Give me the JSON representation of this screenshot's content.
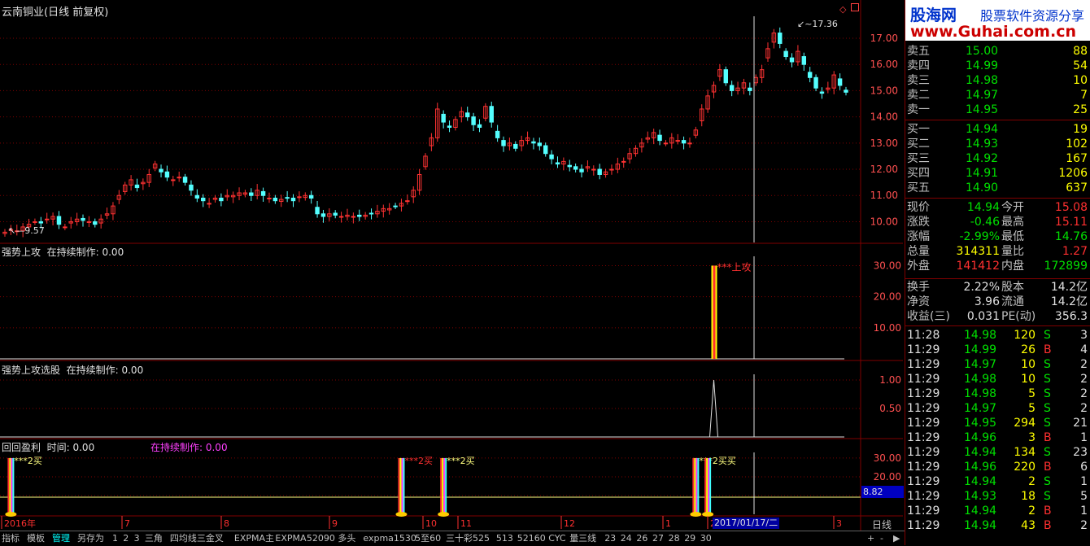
{
  "main_title": "云南铜业(日线 前复权)",
  "panels": {
    "p1_title": "强势上攻  在持续制作: 0.00",
    "p2_title": "强势上攻选股  在持续制作: 0.00",
    "p3_title": "回回盈利  时间: 0.00",
    "p3_subtitle": "在持续制作: 0.00"
  },
  "annotations": {
    "high": "17.36",
    "low": "9.57",
    "up_label": "上攻",
    "buy1": "2买",
    "buy2": "2买",
    "buy3": "2买",
    "buy4": "2买买",
    "value_box": "8.82",
    "date_box": "2017/01/17/二",
    "cycle": "日线"
  },
  "colors": {
    "up": "#ff3232",
    "down": "#54ffff",
    "grid": "#800000",
    "axis_text": "#ff5050",
    "value_box_bg": "#0000c0"
  },
  "chart_data": [
    {
      "type": "candlestick",
      "title": "云南铜业(日线 前复权)",
      "y_ticks": [
        "17.00",
        "16.00",
        "15.00",
        "14.00",
        "13.00",
        "12.00",
        "11.00",
        "10.00"
      ],
      "ylim": [
        9.3,
        17.9
      ],
      "x_ticks": [
        "2016年",
        "7",
        "8",
        "9",
        "10",
        "11",
        "12",
        "1",
        "2",
        "3"
      ],
      "close_series": [
        9.6,
        9.7,
        9.65,
        9.8,
        9.9,
        10.0,
        9.95,
        10.1,
        10.2,
        9.9,
        9.8,
        10.0,
        10.1,
        10.05,
        10.0,
        9.9,
        10.1,
        10.3,
        10.6,
        11.0,
        11.4,
        11.6,
        11.3,
        11.5,
        11.8,
        12.2,
        11.9,
        11.7,
        11.6,
        11.7,
        11.5,
        11.2,
        10.9,
        10.8,
        10.7,
        10.9,
        10.8,
        11.0,
        11.0,
        11.1,
        11.1,
        11.0,
        11.2,
        11.0,
        10.9,
        10.8,
        10.85,
        10.9,
        10.8,
        10.95,
        11.0,
        10.9,
        10.3,
        10.2,
        10.3,
        10.25,
        10.2,
        10.25,
        10.2,
        10.2,
        10.25,
        10.3,
        10.4,
        10.5,
        10.5,
        10.6,
        10.7,
        10.8,
        11.2,
        11.8,
        12.5,
        13.2,
        14.3,
        13.8,
        13.6,
        13.9,
        14.2,
        14.0,
        13.7,
        13.6,
        14.4,
        13.8,
        13.2,
        12.9,
        13.0,
        12.8,
        13.1,
        13.2,
        13.0,
        12.9,
        12.6,
        12.4,
        12.2,
        12.3,
        12.1,
        12.0,
        11.9,
        12.1,
        12.0,
        11.8,
        11.9,
        12.0,
        12.2,
        12.3,
        12.6,
        12.8,
        13.0,
        13.2,
        13.4,
        13.1,
        13.0,
        13.2,
        13.1,
        13.0,
        13.0,
        13.5,
        14.3,
        14.8,
        15.2,
        15.8,
        15.3,
        15.0,
        15.1,
        15.3,
        15.0,
        15.5,
        15.8,
        16.6,
        17.2,
        16.8,
        16.3,
        16.1,
        16.5,
        16.0,
        15.5,
        15.1,
        14.9,
        15.1,
        15.6,
        15.2,
        14.94
      ],
      "annotations": [
        "17.36",
        "9.57"
      ]
    },
    {
      "type": "bar",
      "title": "强势上攻",
      "y_ticks": [
        "30.00",
        "20.00",
        "10.00"
      ],
      "ylim": [
        0,
        33
      ],
      "signal_value": 30,
      "signal_index": 118,
      "label": "上攻"
    },
    {
      "type": "line",
      "title": "强势上攻选股",
      "y_ticks": [
        "1.00",
        "0.50"
      ],
      "ylim": [
        0,
        1.1
      ],
      "signal_value": 1,
      "signal_index": 118
    },
    {
      "type": "bar",
      "title": "回回盈利",
      "y_ticks": [
        "30.00",
        "20.00",
        "10.00"
      ],
      "ylim": [
        0,
        33
      ],
      "signal_indices": [
        1,
        66,
        73,
        115,
        117
      ],
      "signal_value": 30,
      "labels": [
        "2买",
        "2买",
        "2买",
        "2买买"
      ]
    }
  ],
  "quote": {
    "logo_cn": "股海网",
    "logo_slogan": "股票软件资源分享",
    "logo_url": "www.Guhai.com.cn",
    "sell": [
      {
        "label": "卖五",
        "price": "15.00",
        "vol": "88"
      },
      {
        "label": "卖四",
        "price": "14.99",
        "vol": "54"
      },
      {
        "label": "卖三",
        "price": "14.98",
        "vol": "10"
      },
      {
        "label": "卖二",
        "price": "14.97",
        "vol": "7"
      },
      {
        "label": "卖一",
        "price": "14.95",
        "vol": "25"
      }
    ],
    "buy": [
      {
        "label": "买一",
        "price": "14.94",
        "vol": "19"
      },
      {
        "label": "买二",
        "price": "14.93",
        "vol": "102"
      },
      {
        "label": "买三",
        "price": "14.92",
        "vol": "167"
      },
      {
        "label": "买四",
        "price": "14.91",
        "vol": "1206"
      },
      {
        "label": "买五",
        "price": "14.90",
        "vol": "637"
      }
    ],
    "stats": [
      {
        "l1": "现价",
        "v1": "14.94",
        "l2": "今开",
        "v2": "15.08"
      },
      {
        "l1": "涨跌",
        "v1": "-0.46",
        "l2": "最高",
        "v2": "15.11"
      },
      {
        "l1": "涨幅",
        "v1": "-2.99%",
        "l2": "最低",
        "v2": "14.76"
      },
      {
        "l1": "总量",
        "v1": "314311",
        "l2": "量比",
        "v2": "1.27"
      },
      {
        "l1": "外盘",
        "v1": "141412",
        "l2": "内盘",
        "v2": "172899"
      }
    ],
    "fund": [
      {
        "l1": "换手",
        "v1": "2.22%",
        "l2": "股本",
        "v2": "14.2亿"
      },
      {
        "l1": "净资",
        "v1": "3.96",
        "l2": "流通",
        "v2": "14.2亿"
      },
      {
        "l1": "收益(三)",
        "v1": "0.031",
        "l2": "PE(动)",
        "v2": "356.3"
      }
    ],
    "ticks": [
      {
        "t": "11:28",
        "p": "14.98",
        "v": "120",
        "s": "S",
        "n": "3"
      },
      {
        "t": "11:29",
        "p": "14.99",
        "v": "26",
        "s": "B",
        "n": "4"
      },
      {
        "t": "11:29",
        "p": "14.97",
        "v": "10",
        "s": "S",
        "n": "2"
      },
      {
        "t": "11:29",
        "p": "14.98",
        "v": "10",
        "s": "S",
        "n": "2"
      },
      {
        "t": "11:29",
        "p": "14.98",
        "v": "5",
        "s": "S",
        "n": "2"
      },
      {
        "t": "11:29",
        "p": "14.97",
        "v": "5",
        "s": "S",
        "n": "2"
      },
      {
        "t": "11:29",
        "p": "14.95",
        "v": "294",
        "s": "S",
        "n": "21"
      },
      {
        "t": "11:29",
        "p": "14.96",
        "v": "3",
        "s": "B",
        "n": "1"
      },
      {
        "t": "11:29",
        "p": "14.94",
        "v": "134",
        "s": "S",
        "n": "23"
      },
      {
        "t": "11:29",
        "p": "14.96",
        "v": "220",
        "s": "B",
        "n": "6"
      },
      {
        "t": "11:29",
        "p": "14.94",
        "v": "2",
        "s": "S",
        "n": "1"
      },
      {
        "t": "11:29",
        "p": "14.93",
        "v": "18",
        "s": "S",
        "n": "5"
      },
      {
        "t": "11:29",
        "p": "14.94",
        "v": "2",
        "s": "B",
        "n": "1"
      },
      {
        "t": "11:29",
        "p": "14.94",
        "v": "43",
        "s": "B",
        "n": "2"
      }
    ]
  },
  "toolbar": [
    "指标",
    "模板",
    "管理",
    "另存为",
    "1",
    "2",
    "3",
    "三角",
    "四均线三金叉",
    "EXPMA主",
    "EXPMA",
    "52090",
    "多头",
    "expma1530",
    "5至60",
    "三十彩525",
    "513",
    "52160",
    "CYC",
    "量三线",
    "23",
    "24",
    "26",
    "27",
    "28",
    "29",
    "30"
  ],
  "toolbar_active": "管理",
  "nav_controls": [
    "+",
    "-",
    "▶"
  ]
}
